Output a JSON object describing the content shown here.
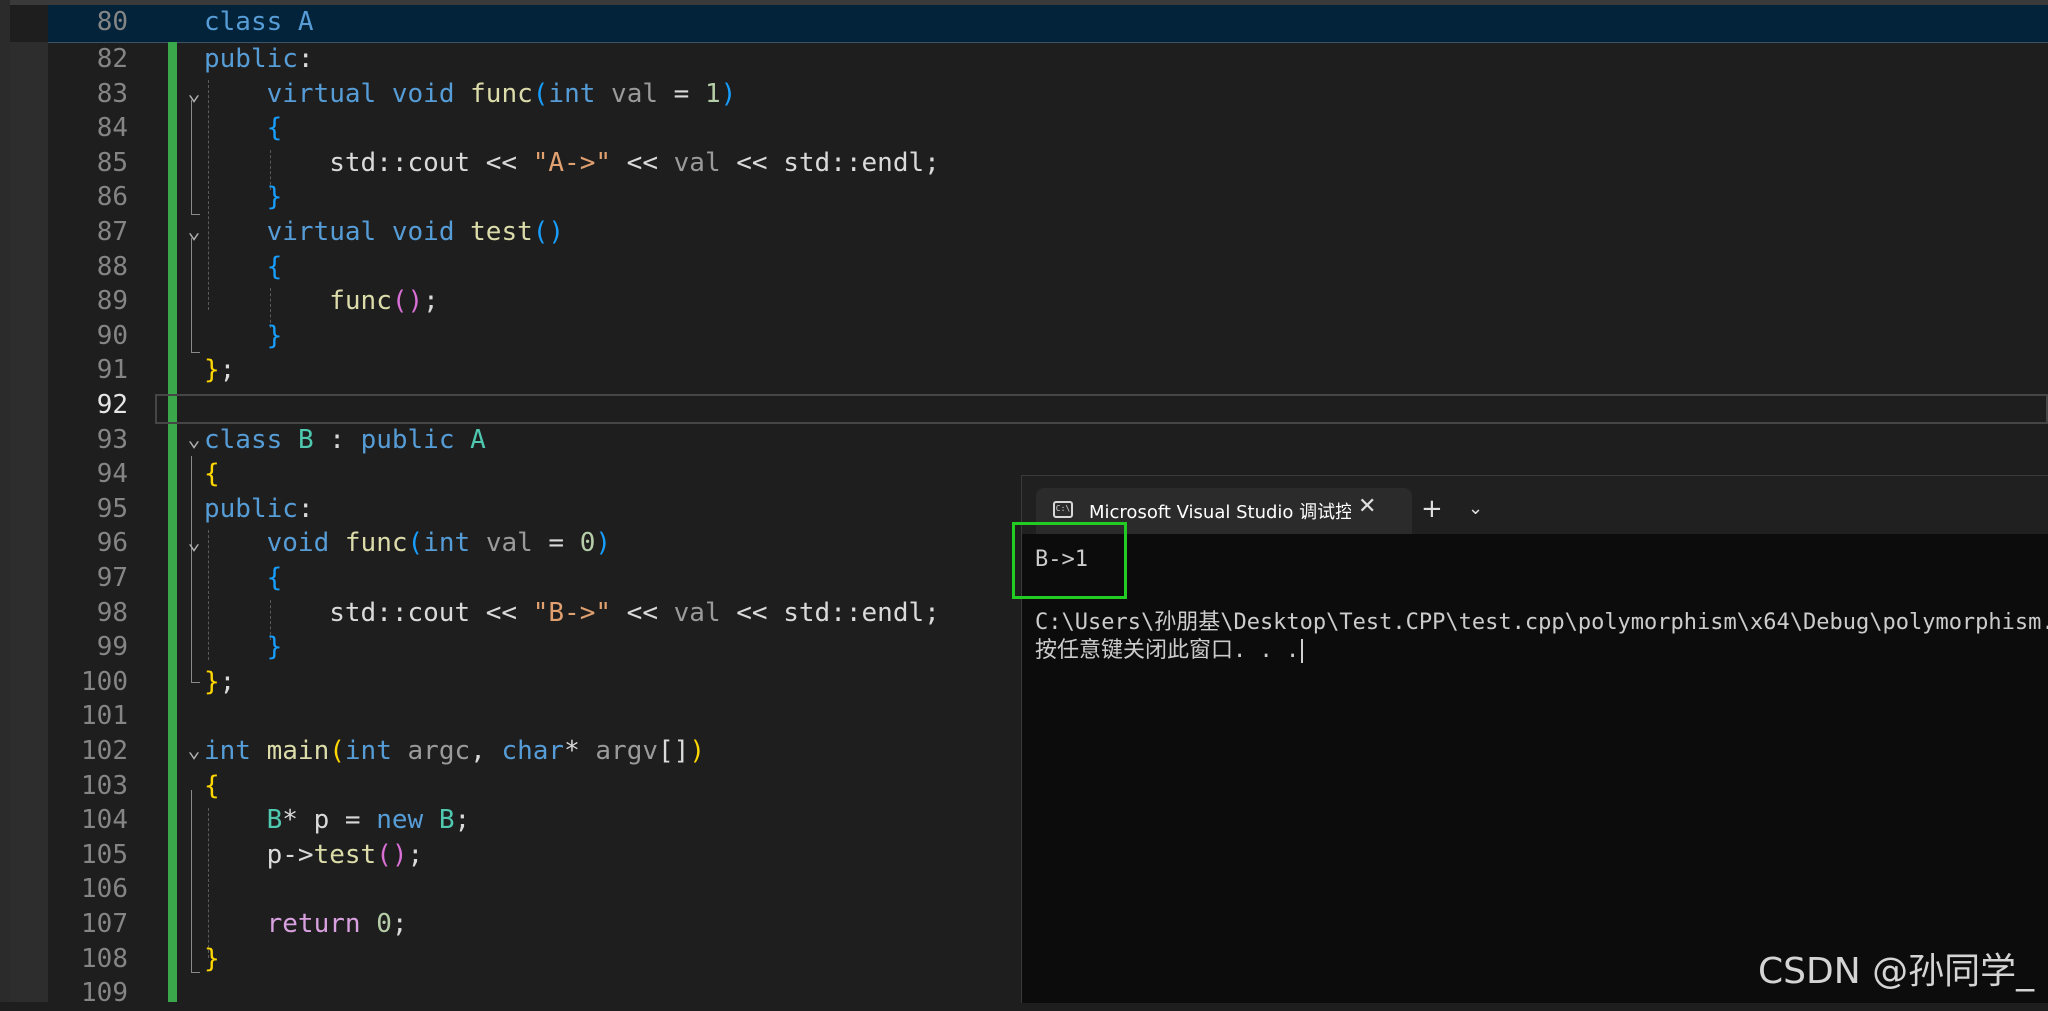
{
  "editor": {
    "sticky_line_number": "80",
    "sticky_code": "class A",
    "active_line": "92",
    "lines": [
      {
        "n": "82"
      },
      {
        "n": "83"
      },
      {
        "n": "84"
      },
      {
        "n": "85"
      },
      {
        "n": "86"
      },
      {
        "n": "87"
      },
      {
        "n": "88"
      },
      {
        "n": "89"
      },
      {
        "n": "90"
      },
      {
        "n": "91"
      },
      {
        "n": "92"
      },
      {
        "n": "93"
      },
      {
        "n": "94"
      },
      {
        "n": "95"
      },
      {
        "n": "96"
      },
      {
        "n": "97"
      },
      {
        "n": "98"
      },
      {
        "n": "99"
      },
      {
        "n": "100"
      },
      {
        "n": "101"
      },
      {
        "n": "102"
      },
      {
        "n": "103"
      },
      {
        "n": "104"
      },
      {
        "n": "105"
      },
      {
        "n": "106"
      },
      {
        "n": "107"
      },
      {
        "n": "108"
      },
      {
        "n": "109"
      }
    ],
    "tokens": {
      "public": "public",
      "colon": ":",
      "virtual": "virtual",
      "void": "void",
      "func": "func",
      "lparen": "(",
      "rparen": ")",
      "int": "int",
      "val": "val",
      "eq": " = ",
      "one": "1",
      "zero": "0",
      "lbrace": "{",
      "rbrace": "}",
      "std_cout": "std::cout",
      "shift": " << ",
      "str_a": "\"A->\"",
      "str_b": "\"B->\"",
      "std_endl": "std::endl",
      "semi": ";",
      "test": "test",
      "class": "class",
      "A": "A",
      "B": "B",
      "colon_sp": " : ",
      "main": "main",
      "argc": "argc",
      "comma": ", ",
      "char": "char",
      "star": "*",
      "argv": "argv",
      "brackets": "[]",
      "p": "p",
      "new": "new",
      "arrow": "->",
      "return": "return",
      "eq2": " = "
    }
  },
  "terminal": {
    "tab_icon": "terminal-icon",
    "tab_title": "Microsoft Visual Studio 调试控制台",
    "close_glyph": "✕",
    "new_tab_glyph": "+",
    "dropdown_glyph": "⌄",
    "output_line_1": "B->1",
    "output_line_2": "C:\\Users\\孙朋基\\Desktop\\Test.CPP\\test.cpp\\polymorphism\\x64\\Debug\\polymorphism.exe",
    "output_line_3": "按任意键关闭此窗口. . ."
  },
  "watermark": "CSDN @孙同学_"
}
